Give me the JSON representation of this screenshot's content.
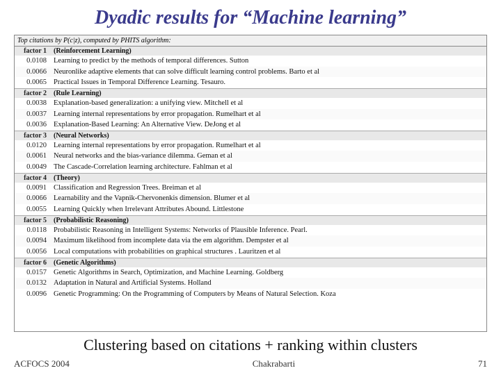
{
  "title": "Dyadic results for “Machine learning”",
  "table": {
    "header": "Top citations by P(c|z), computed by PHITS algorithm:",
    "factors": [
      {
        "label": "factor 1",
        "category": "(Reinforcement Learning)",
        "entries": [
          {
            "score": "0.0108",
            "text": "Learning to predict by the methods of temporal differences. Sutton"
          },
          {
            "score": "0.0066",
            "text": "Neuronlike adaptive elements that can solve difficult learning control problems. Barto et al"
          },
          {
            "score": "0.0065",
            "text": "Practical Issues in Temporal Difference Learning. Tesauro."
          }
        ]
      },
      {
        "label": "factor 2",
        "category": "(Rule Learning)",
        "entries": [
          {
            "score": "0.0038",
            "text": "Explanation-based generalization: a unifying view. Mitchell et al"
          },
          {
            "score": "0.0037",
            "text": "Learning internal representations by error propagation. Rumelhart et al"
          },
          {
            "score": "0.0036",
            "text": "Explanation-Based Learning: An Alternative View. DeJong et al"
          }
        ]
      },
      {
        "label": "factor 3",
        "category": "(Neural Networks)",
        "entries": [
          {
            "score": "0.0120",
            "text": "Learning internal representations by error propagation. Rumelhart et al"
          },
          {
            "score": "0.0061",
            "text": "Neural networks and the bias-variance dilemma. Geman et al"
          },
          {
            "score": "0.0049",
            "text": "The Cascade-Correlation learning architecture. Fahlman et al"
          }
        ]
      },
      {
        "label": "factor 4",
        "category": "(Theory)",
        "entries": [
          {
            "score": "0.0091",
            "text": "Classification and Regression Trees. Breiman et al"
          },
          {
            "score": "0.0066",
            "text": "Learnability and the Vapnik-Chervonenkis dimension. Blumer et al"
          },
          {
            "score": "0.0055",
            "text": "Learning Quickly when Irrelevant Attributes Abound. Littlestone"
          }
        ]
      },
      {
        "label": "factor 5",
        "category": "(Probabilistic Reasoning)",
        "entries": [
          {
            "score": "0.0118",
            "text": "Probabilistic Reasoning in Intelligent Systems: Networks of Plausible Inference. Pearl."
          },
          {
            "score": "0.0094",
            "text": "Maximum likelihood from incomplete data via the em algorithm. Dempster et al"
          },
          {
            "score": "0.0056",
            "text": "Local computations with probabilities on graphical structures . Lauritzen et al"
          }
        ]
      },
      {
        "label": "factor 6",
        "category": "(Genetic Algorithms)",
        "entries": [
          {
            "score": "0.0157",
            "text": "Genetic Algorithms in Search, Optimization, and Machine Learning. Goldberg"
          },
          {
            "score": "0.0132",
            "text": "Adaptation in Natural and Artificial Systems. Holland"
          },
          {
            "score": "0.0096",
            "text": "Genetic Programming: On the Programming of Computers by Means of Natural Selection. Koza"
          }
        ]
      }
    ]
  },
  "subtitle": "Clustering based on citations + ranking within clusters",
  "footer": {
    "left": "ACFOCS 2004",
    "center": "Chakrabarti",
    "right": "71"
  }
}
